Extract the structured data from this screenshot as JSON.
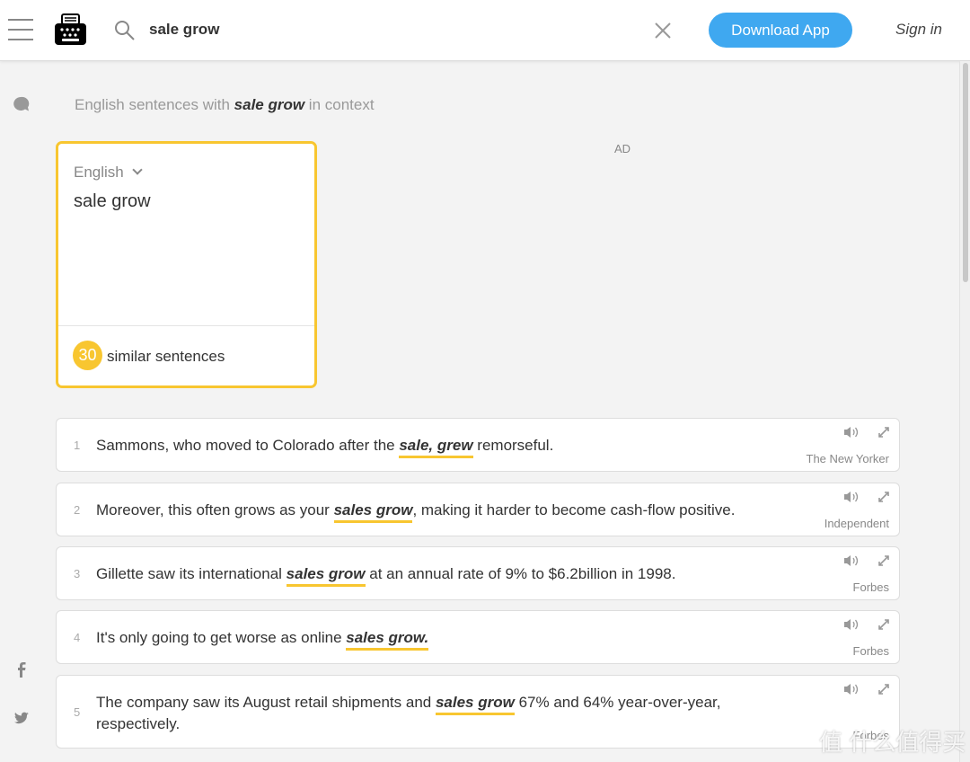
{
  "header": {
    "query": "sale grow",
    "download_label": "Download App",
    "signin_label": "Sign in"
  },
  "context": {
    "prefix": "English sentences with ",
    "term": "sale grow",
    "suffix": " in context"
  },
  "ad_label": "AD",
  "query_card": {
    "language": "English",
    "text": "sale grow",
    "count": "30",
    "similar_label": "similar sentences"
  },
  "sentences": [
    {
      "n": "1",
      "pre": "Sammons, who moved to Colorado after the ",
      "hl": "sale, grew",
      "post": " remorseful.",
      "source": "The New Yorker"
    },
    {
      "n": "2",
      "pre": "Moreover, this often grows as your ",
      "hl": "sales grow",
      "post": ", making it harder to become cash-flow positive.",
      "source": "Independent"
    },
    {
      "n": "3",
      "pre": "Gillette saw its international ",
      "hl": "sales grow",
      "post": " at an annual rate of 9% to $6.2billion in 1998.",
      "source": "Forbes"
    },
    {
      "n": "4",
      "pre": "It's only going to get worse as online ",
      "hl": "sales grow.",
      "post": "",
      "source": "Forbes"
    },
    {
      "n": "5",
      "pre": "The company saw its August retail shipments and ",
      "hl": "sales grow",
      "post": " 67% and 64% year-over-year, respectively.",
      "source": "Forbes"
    }
  ],
  "watermark": "值 什么值得买",
  "colors": {
    "accent": "#f8c630",
    "button": "#3fa8f0"
  }
}
